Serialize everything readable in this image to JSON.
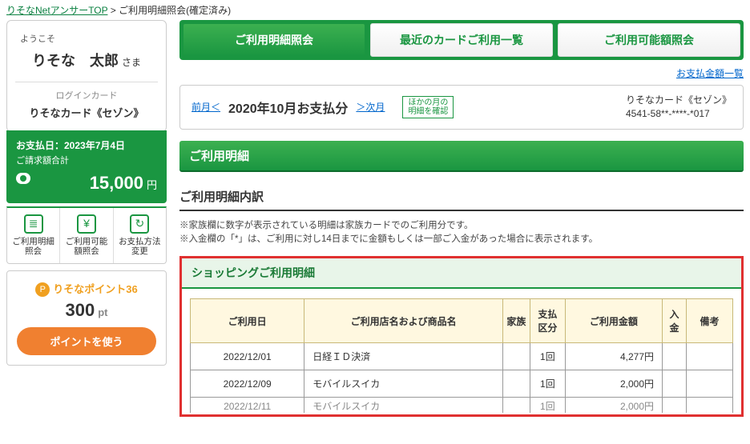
{
  "breadcrumb": {
    "top_link": "りそなNetアンサーTOP",
    "sep": " > ",
    "current": "ご利用明細照会(確定済み)"
  },
  "sidebar": {
    "welcome": "ようこそ",
    "user_name": "りそな　太郎",
    "sama": "さま",
    "login_card_label": "ログインカード",
    "login_card_name": "りそなカード《セゾン》",
    "pay_date": "お支払日：2023年7月4日",
    "pay_total_label": "ご請求額合計",
    "amount": "15,000",
    "yen": "円",
    "actions": [
      {
        "icon": "≣",
        "label": "ご利用明細照会"
      },
      {
        "icon": "¥",
        "label": "ご利用可能額照会"
      },
      {
        "icon": "↻",
        "label": "お支払方法変更"
      }
    ],
    "points": {
      "brand": "りそなポイント36",
      "value": "300",
      "unit": "pt",
      "button": "ポイントを使う"
    }
  },
  "tabs": [
    {
      "label": "ご利用明細照会",
      "active": true
    },
    {
      "label": "最近のカードご利用一覧",
      "active": false
    },
    {
      "label": "ご利用可能額照会",
      "active": false
    }
  ],
  "top_link": "お支払金額一覧",
  "month_box": {
    "prev": "前月＜",
    "title": "2020年10月お支払分",
    "next": "＞次月",
    "small1": "ほかの月の",
    "small2": "明細を確認",
    "card_name": "りそなカード《セゾン》",
    "card_no": "4541-58**-****-*017"
  },
  "section_header": "ご利用明細",
  "sub_header": "ご利用明細内訳",
  "notes": {
    "l1": "※家族欄に数字が表示されている明細は家族カードでのご利用分です。",
    "l2": "※入金欄の「*」は、ご利用に対し14日までに金額もしくは一部ご入金があった場合に表示されます。"
  },
  "shopping_header": "ショッピングご利用明細",
  "table": {
    "headers": [
      "ご利用日",
      "ご利用店名および商品名",
      "家族",
      "支払区分",
      "ご利用金額",
      "入金",
      "備考"
    ],
    "rows": [
      {
        "date": "2022/12/01",
        "shop": "日経ＩＤ決済",
        "family": "",
        "type": "1回",
        "amount": "4,277円",
        "pay": "",
        "note": ""
      },
      {
        "date": "2022/12/09",
        "shop": "モバイルスイカ",
        "family": "",
        "type": "1回",
        "amount": "2,000円",
        "pay": "",
        "note": ""
      },
      {
        "date": "2022/12/11",
        "shop": "モバイルスイカ",
        "family": "",
        "type": "1回",
        "amount": "2,000円",
        "pay": "",
        "note": ""
      }
    ]
  }
}
